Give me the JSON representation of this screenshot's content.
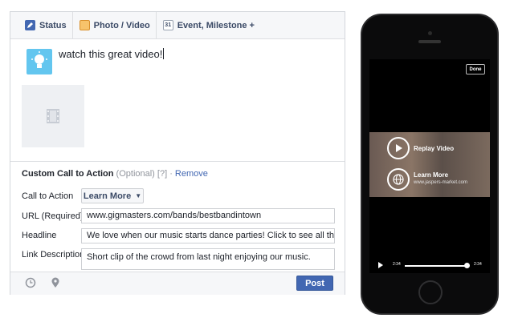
{
  "composer": {
    "tabs": [
      {
        "label": "Status",
        "icon": "pencil-icon"
      },
      {
        "label": "Photo / Video",
        "icon": "photo-icon"
      },
      {
        "label": "Event, Milestone +",
        "icon": "calendar-icon"
      }
    ],
    "calendar_day": "31",
    "post_text": "watch this great video!",
    "cta": {
      "title": "Custom Call to Action",
      "optional": "(Optional)",
      "help": "[?]",
      "separator": " · ",
      "remove": "Remove",
      "call_to_action_label": "Call to Action",
      "call_to_action_value": "Learn More",
      "url_label": "URL (Required)",
      "url_value": "www.gigmasters.com/bands/bestbandintown",
      "headline_label": "Headline",
      "headline_value": "We love when our music starts dance parties! Click to see all the fun.",
      "link_description_label": "Link Description",
      "link_description_value": "Short clip of the crowd from last night enjoying our music."
    },
    "footer": {
      "post_label": "Post"
    },
    "colors": {
      "brand": "#4267b2",
      "bulb": "#63c6ef"
    }
  },
  "phone": {
    "done_label": "Done",
    "replay_label": "Replay Video",
    "learn_more_label": "Learn More",
    "learn_more_url": "www.jaspers-market.com",
    "time_elapsed": "2:34",
    "time_total": "2:34",
    "progress": 1.0
  }
}
